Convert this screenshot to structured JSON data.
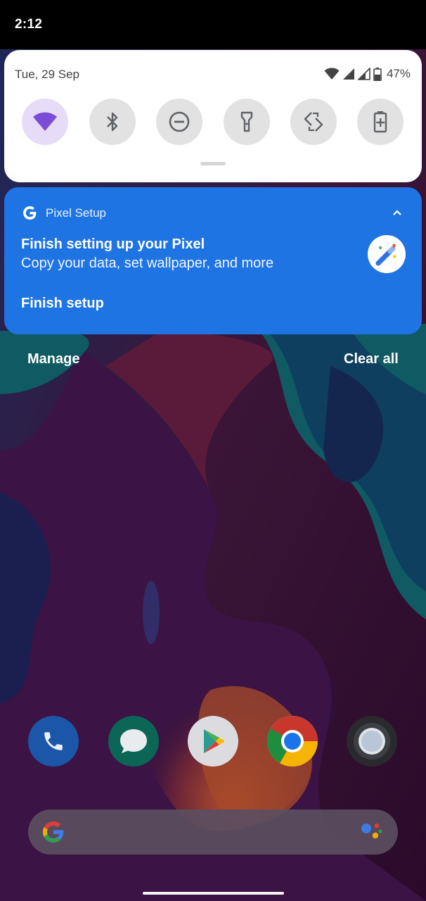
{
  "status_bar": {
    "time": "2:12"
  },
  "quick_settings": {
    "date": "Tue, 29 Sep",
    "battery_percent": "47%",
    "icons": [
      "wifi-icon",
      "cell-signal-icon",
      "cell-signal-icon",
      "battery-icon"
    ],
    "tiles": [
      {
        "name": "wifi",
        "icon": "wifi-icon",
        "active": true
      },
      {
        "name": "bluetooth",
        "icon": "bluetooth-icon",
        "active": false
      },
      {
        "name": "do-not-disturb",
        "icon": "do-not-disturb-icon",
        "active": false
      },
      {
        "name": "flashlight",
        "icon": "flashlight-icon",
        "active": false
      },
      {
        "name": "auto-rotate",
        "icon": "auto-rotate-icon",
        "active": false
      },
      {
        "name": "battery-saver",
        "icon": "battery-saver-icon",
        "active": false
      }
    ]
  },
  "notification": {
    "app_name": "Pixel Setup",
    "title": "Finish setting up your Pixel",
    "body": "Copy your data, set wallpaper, and more",
    "action": "Finish setup",
    "app_icon": "google-g-icon",
    "large_icon": "magic-wand-icon",
    "accent_color": "#1f74e4"
  },
  "shade_actions": {
    "manage": "Manage",
    "clear_all": "Clear all"
  },
  "dock": [
    "phone-icon",
    "messages-icon",
    "play-store-icon",
    "chrome-icon",
    "camera-icon"
  ],
  "search": {
    "left_icon": "google-g-icon",
    "right_icon": "assistant-icon"
  }
}
